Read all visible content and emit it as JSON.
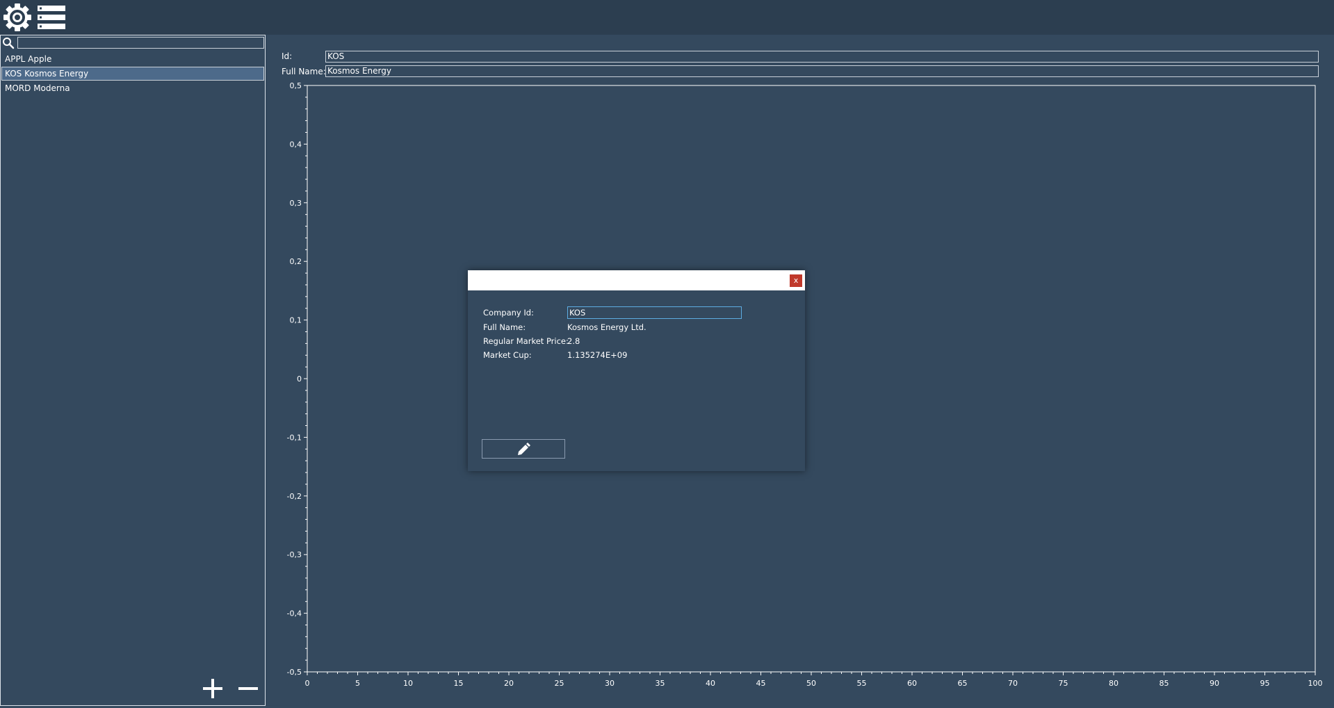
{
  "toolbar": {
    "settings_icon": "gear-icon",
    "menu_icon": "list-icon"
  },
  "sidebar": {
    "search": {
      "placeholder": "",
      "value": ""
    },
    "items": [
      {
        "label": "APPL Apple",
        "selected": false
      },
      {
        "label": "KOS Kosmos Energy",
        "selected": true
      },
      {
        "label": "MORD Moderna",
        "selected": false
      }
    ],
    "add_icon": "plus-icon",
    "remove_icon": "minus-icon"
  },
  "details": {
    "id_label": "Id:",
    "id_value": "KOS",
    "fullname_label": "Full Name:",
    "fullname_value": "Kosmos Energy"
  },
  "chart_data": {
    "type": "line",
    "series": [],
    "xlim": [
      0,
      100
    ],
    "ylim": [
      -0.5,
      0.5
    ],
    "x_ticks": [
      "0",
      "5",
      "10",
      "15",
      "20",
      "25",
      "30",
      "35",
      "40",
      "45",
      "50",
      "55",
      "60",
      "65",
      "70",
      "75",
      "80",
      "85",
      "90",
      "95",
      "100"
    ],
    "y_ticks": [
      "0,5",
      "0,4",
      "0,3",
      "0,2",
      "0,1",
      "0",
      "-0,1",
      "-0,2",
      "-0,3",
      "-0,4",
      "-0,5"
    ],
    "grid": false,
    "axis_color": "#ffffff"
  },
  "dialog": {
    "close_label": "x",
    "company_id_label": "Company Id:",
    "company_id_value": "KOS",
    "full_name_label": "Full Name:",
    "full_name_value": "Kosmos Energy Ltd.",
    "price_label": "Regular Market Price:",
    "price_value": "2.8",
    "market_cap_label": "Market Cup:",
    "market_cap_value": "1.135274E+09",
    "edit_icon": "pencil-icon"
  },
  "colors": {
    "background": "#34495e",
    "topbar": "#2c3e50",
    "selected": "#4d6a8a",
    "close": "#c0392b",
    "focus": "#5dade2"
  }
}
